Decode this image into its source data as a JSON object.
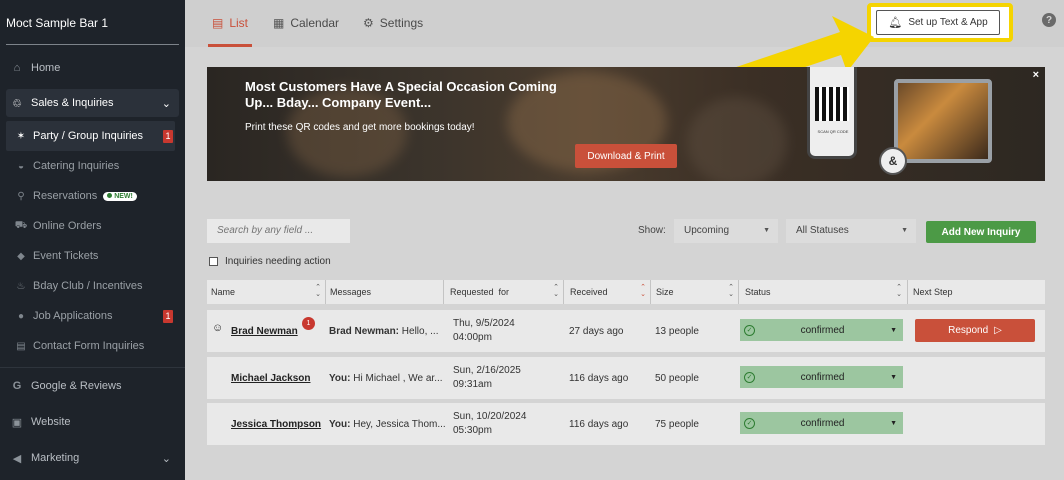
{
  "sidebar": {
    "brand": "Moct Sample Bar 1",
    "home": "Home",
    "sales": "Sales & Inquiries",
    "items": [
      {
        "label": "Party / Group Inquiries",
        "badge": "1"
      },
      {
        "label": "Catering Inquiries"
      },
      {
        "label": "Reservations",
        "badge_new": "NEW!"
      },
      {
        "label": "Online Orders"
      },
      {
        "label": "Event Tickets"
      },
      {
        "label": "Bday Club / Incentives"
      },
      {
        "label": "Job Applications",
        "badge": "1"
      },
      {
        "label": "Contact Form Inquiries"
      }
    ],
    "sections": [
      "Google & Reviews",
      "Website",
      "Marketing"
    ]
  },
  "tabs": {
    "list": "List",
    "calendar": "Calendar",
    "settings": "Settings"
  },
  "setup_button": "Set up Text & App",
  "help": "?",
  "banner": {
    "title": "Most Customers Have A Special Occasion Coming Up... Bday... Company Event...",
    "subtitle": "Print these QR codes and get more bookings today!",
    "button": "Download & Print",
    "qr_caption": "SCAN QR CODE",
    "close": "×"
  },
  "filters": {
    "search_placeholder": "Search by any field ...",
    "show_label": "Show:",
    "show_value": "Upcoming",
    "status_value": "All Statuses",
    "add_button": "Add New Inquiry",
    "needing_action": "Inquiries needing action"
  },
  "table": {
    "headers": [
      "Name",
      "Messages",
      "Requested  for",
      "Received",
      "Size",
      "Status",
      "Next Step"
    ],
    "rows": [
      {
        "name": "Brad Newman",
        "unread": "1",
        "msg_from": "Brad Newman:",
        "msg_text": " Hello, ...",
        "req_date": "Thu, 9/5/2024",
        "req_time": "04:00pm",
        "received": "27 days ago",
        "size": "13 people",
        "status": "confirmed",
        "next": "Respond"
      },
      {
        "name": "Michael Jackson",
        "msg_from": "You:",
        "msg_text": " Hi Michael , We ar...",
        "req_date": "Sun, 2/16/2025",
        "req_time": "09:31am",
        "received": "116 days ago",
        "size": "50 people",
        "status": "confirmed"
      },
      {
        "name": "Jessica Thompson",
        "msg_from": "You:",
        "msg_text": " Hey, Jessica Thom...",
        "req_date": "Sun, 10/20/2024",
        "req_time": "05:30pm",
        "received": "116 days ago",
        "size": "75 people",
        "status": "confirmed"
      }
    ]
  }
}
